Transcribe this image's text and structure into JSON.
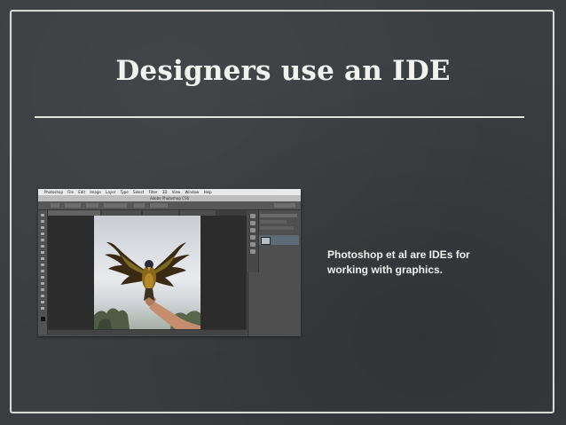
{
  "slide": {
    "title": "Designers use an IDE",
    "caption_line1": "Photoshop et al are IDEs for",
    "caption_line2": "working with graphics."
  },
  "screenshot": {
    "menu": [
      "Photoshop",
      "File",
      "Edit",
      "Image",
      "Layer",
      "Type",
      "Select",
      "Filter",
      "3D",
      "View",
      "Window",
      "Help"
    ],
    "window_title": "Adobe Photoshop CS6"
  },
  "colors": {
    "background": "#3b3e41",
    "frame": "#d8d8d4",
    "text": "#f2f2ee"
  }
}
